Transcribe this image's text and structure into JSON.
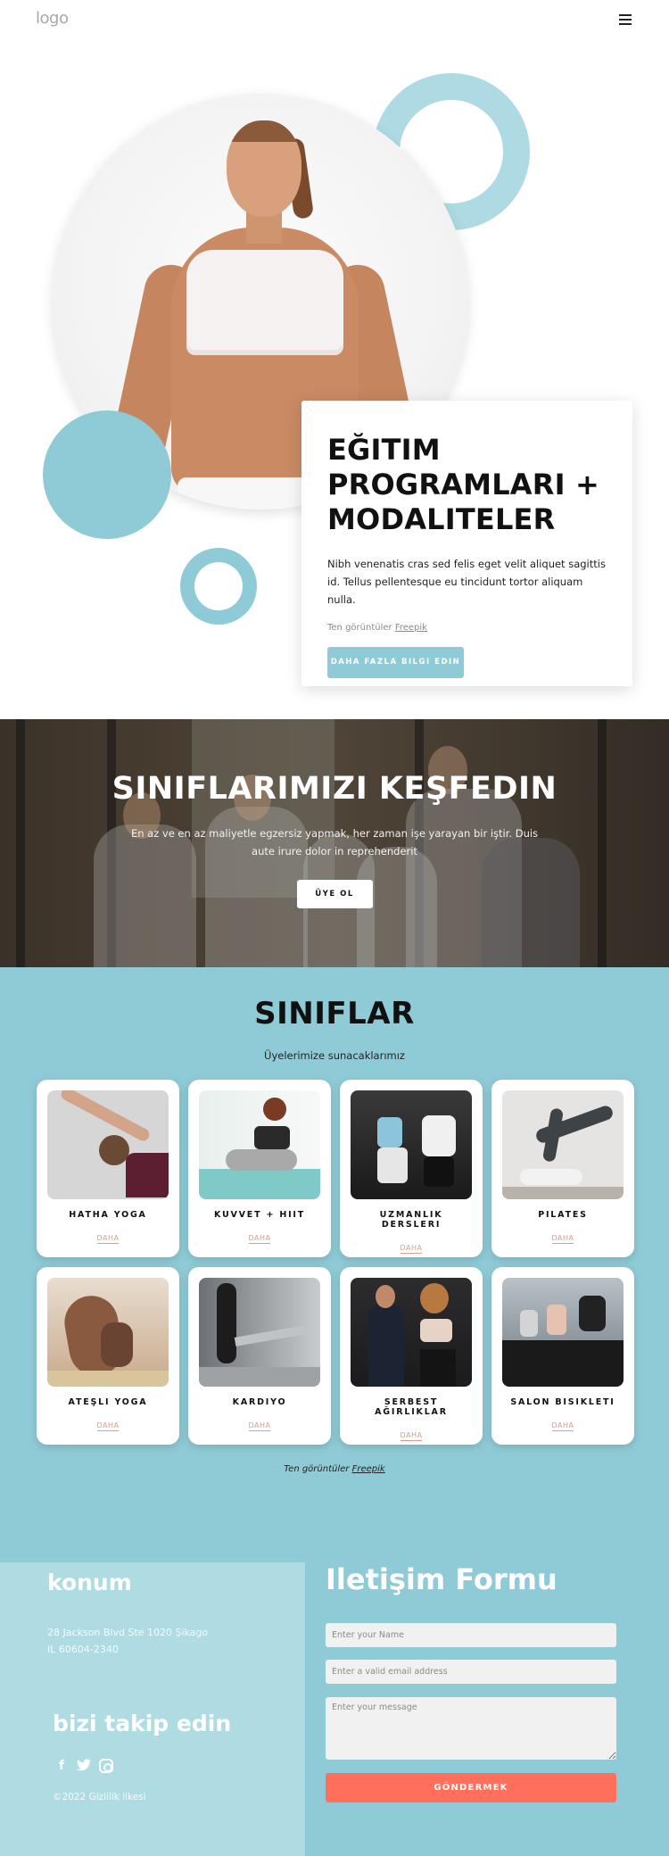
{
  "header": {
    "logo": "logo",
    "menu_icon": "hamburger-menu-icon"
  },
  "hero": {
    "title": "EĞITIM PROGRAMLARI + MODALITELER",
    "text": "Nibh venenatis cras sed felis eget velit aliquet sagittis id. Tellus pellentesque eu tincidunt tortor aliquam nulla.",
    "credit_prefix": "Ten görüntüler",
    "credit_link": "Freepik",
    "button": "DAHA FAZLA BILGI EDIN",
    "image": "smiling-woman-in-white-sports-bra"
  },
  "discover": {
    "title": "SINIFLARIMIZI KEŞFEDIN",
    "text": "En az ve en az maliyetle egzersiz yapmak, her zaman işe yarayan bir iştir. Duis aute irure dolor in reprehenderit",
    "button": "ÜYE OL",
    "image": "group-of-gym-members"
  },
  "classes": {
    "title": "SINIFLAR",
    "subtitle": "Üyelerimize sunacaklarımız",
    "items": [
      {
        "title": "HATHA YOGA",
        "link": "DAHA",
        "image": "woman-yoga-stretch"
      },
      {
        "title": "KUVVET + HIIT",
        "link": "DAHA",
        "image": "woman-stretching-on-mat"
      },
      {
        "title": "UZMANLIK DERSLERI",
        "link": "DAHA",
        "image": "couple-doing-lunges"
      },
      {
        "title": "PILATES",
        "link": "DAHA",
        "image": "woman-shoulder-stand"
      },
      {
        "title": "ATEŞLI YOGA",
        "link": "DAHA",
        "image": "woman-bow-pose"
      },
      {
        "title": "KARDIYO",
        "link": "DAHA",
        "image": "woman-on-treadmill"
      },
      {
        "title": "SERBEST AĞIRLIKLAR",
        "link": "DAHA",
        "image": "couple-with-dumbbells"
      },
      {
        "title": "SALON BISIKLETI",
        "link": "DAHA",
        "image": "spin-class"
      }
    ],
    "credit_prefix": "Ten görüntüler",
    "credit_link": "Freepik"
  },
  "footer": {
    "location_title": "konum",
    "address_line1": "28 Jackson Blvd Ste 1020 Şikago",
    "address_line2": "IL 60604-2340",
    "follow_title": "bizi takip edin",
    "socials": [
      "facebook-icon",
      "twitter-icon",
      "instagram-icon"
    ],
    "copyright": "©2022 Gizlilik ilkesi",
    "form": {
      "title": "Iletişim Formu",
      "name_placeholder": "Enter your Name",
      "email_placeholder": "Enter a valid email address",
      "message_placeholder": "Enter your message",
      "submit": "GÖNDERMEK"
    }
  },
  "colors": {
    "accent": "#8fcbd7",
    "accent_light": "#afdbe3",
    "submit": "#ff6f5b",
    "link": "#d49f90"
  }
}
